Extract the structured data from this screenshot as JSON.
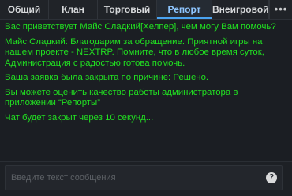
{
  "tabs": [
    {
      "label": "Общий"
    },
    {
      "label": "Клан"
    },
    {
      "label": "Торговый"
    },
    {
      "label": "Репорт",
      "active": true
    },
    {
      "label": "Внеигровой"
    }
  ],
  "more_label": "•••",
  "messages": [
    "Вас приветствует Майс Сладкий[Хелпер], чем могу Вам помочь?",
    "Майс Сладкий: Благодарим за обращение. Приятной игры на нашем проекте - NEXTRP. Помните, что в любое время суток, Администрация с радостью готова помочь.",
    "Ваша заявка была закрыта по причине: Решено.",
    "Вы можете оценить качество работы администратора в приложении “Репорты”",
    "Чат будет закрыт через 10 секунд..."
  ],
  "input": {
    "placeholder": "Введите текст сообщения",
    "value": ""
  },
  "help_icon": "question-icon",
  "colors": {
    "message_text": "#21e021",
    "active_tab_text": "#8fc6ff",
    "active_tab_underline": "#4aa3f0",
    "background": "#1b1e23"
  }
}
